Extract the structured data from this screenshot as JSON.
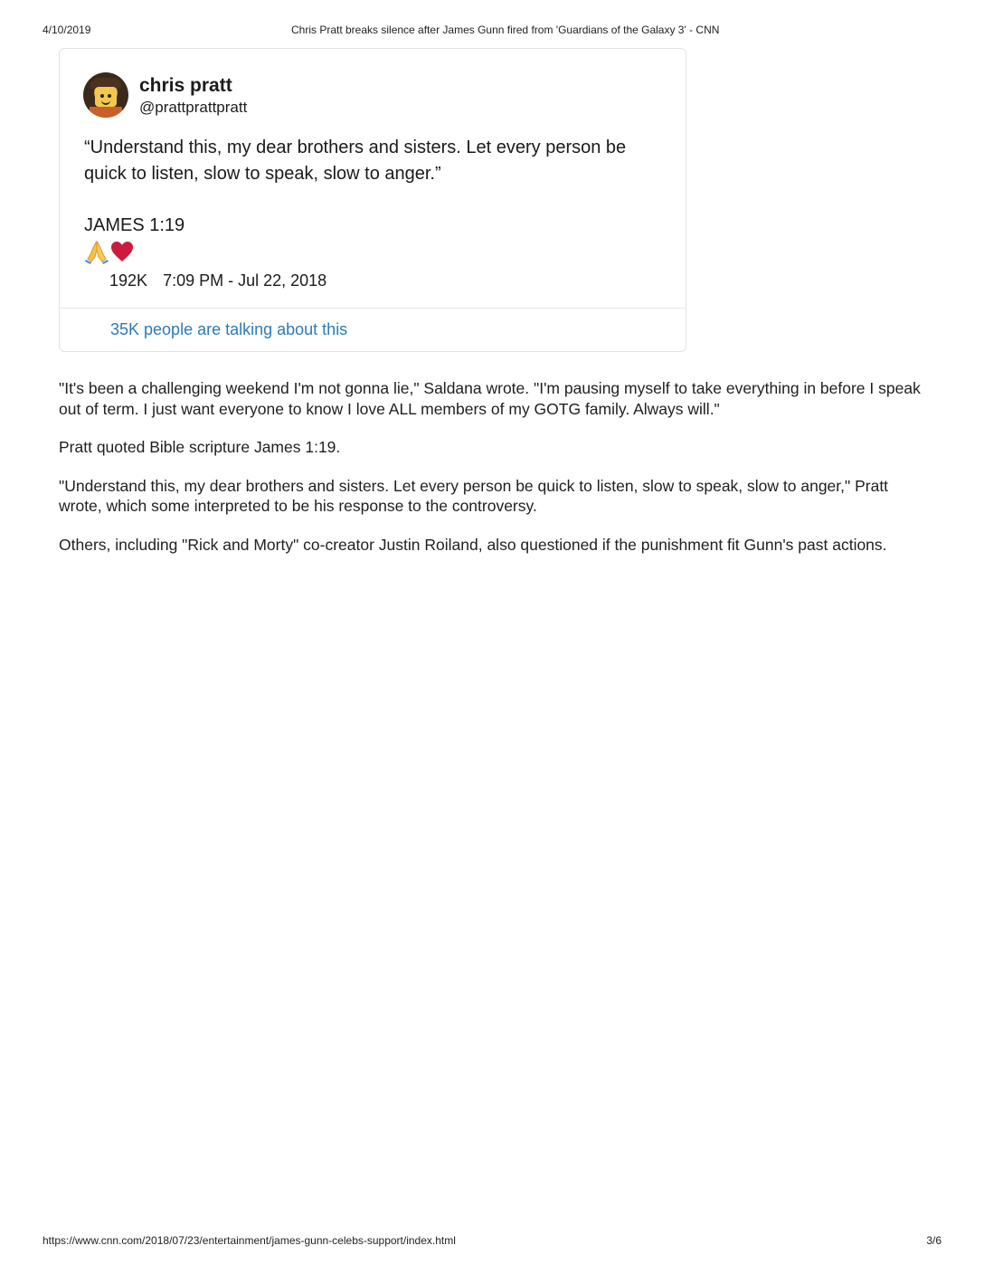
{
  "print_header": {
    "date": "4/10/2019",
    "title": "Chris Pratt breaks silence after James Gunn fired from 'Guardians of the Galaxy 3' - CNN"
  },
  "tweet": {
    "author_name": "chris pratt",
    "author_handle": "@prattprattpratt",
    "text": "“Understand this, my dear brothers and sisters. Let every person be quick to listen, slow to speak, slow to anger.”",
    "reference": "JAMES 1:19",
    "emojis": [
      "folded-hands-icon",
      "heart-icon"
    ],
    "likes": "192K",
    "timestamp": "7:09 PM - Jul 22, 2018",
    "talking_link": "35K people are talking about this",
    "link_color": "#2b7bb9",
    "heart_color": "#cc1b3c"
  },
  "article": {
    "paragraphs": [
      "\"It's been a challenging weekend I'm not gonna lie,\" Saldana wrote. \"I'm pausing myself to take everything in before I speak out of term. I just want everyone to know I love ALL members of my GOTG family. Always will.\"",
      "Pratt quoted Bible scripture James 1:19.",
      "\"Understand this, my dear brothers and sisters. Let every person be quick to listen, slow to speak, slow to anger,\" Pratt wrote, which some interpreted to be his response to the controversy.",
      "Others, including \"Rick and Morty\" co-creator Justin Roiland, also questioned if the punishment fit Gunn's past actions."
    ]
  },
  "print_footer": {
    "url": "https://www.cnn.com/2018/07/23/entertainment/james-gunn-celebs-support/index.html",
    "page": "3/6"
  }
}
